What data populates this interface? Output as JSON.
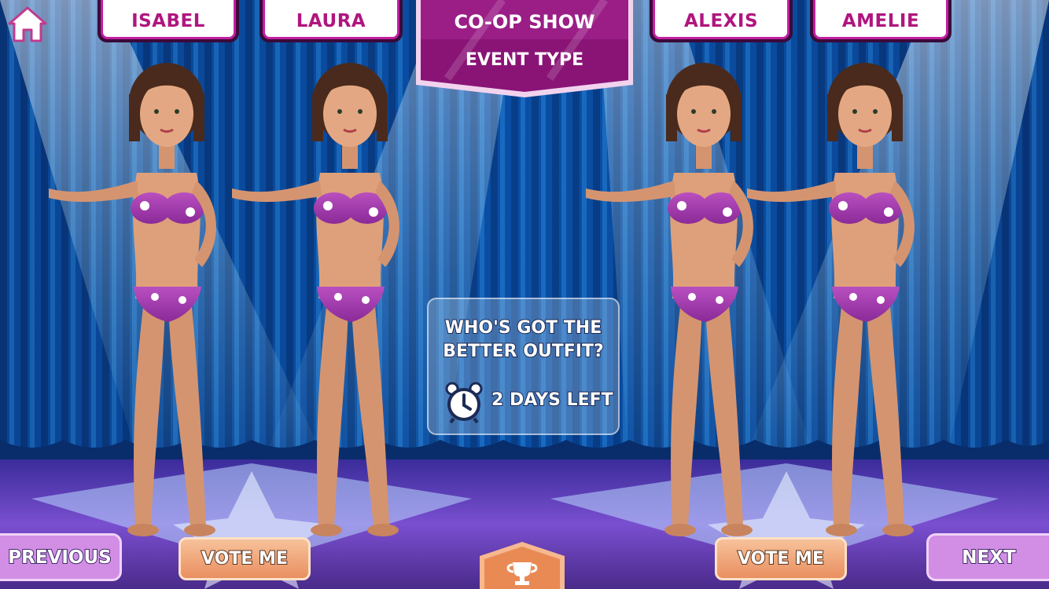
{
  "contestants": [
    {
      "name": "ISABEL"
    },
    {
      "name": "LAURA"
    },
    {
      "name": "ALEXIS"
    },
    {
      "name": "AMELIE"
    }
  ],
  "banner": {
    "line1": "CO-OP SHOW",
    "line2": "EVENT TYPE"
  },
  "prompt": {
    "question": "WHO'S GOT THE BETTER OUTFIT?",
    "time_left": "2 DAYS LEFT"
  },
  "buttons": {
    "previous": "PREVIOUS",
    "next": "NEXT",
    "vote_left": "VOTE ME",
    "vote_right": "VOTE ME"
  },
  "icons": {
    "home": "home-icon",
    "clock": "alarm-clock-icon",
    "trophy": "trophy-icon"
  },
  "colors": {
    "accent": "#b0167f",
    "banner": "#8a1476",
    "nav_button": "#d28ee4",
    "vote_button": "#ec9a6c",
    "curtain": "#0b4aa0"
  }
}
